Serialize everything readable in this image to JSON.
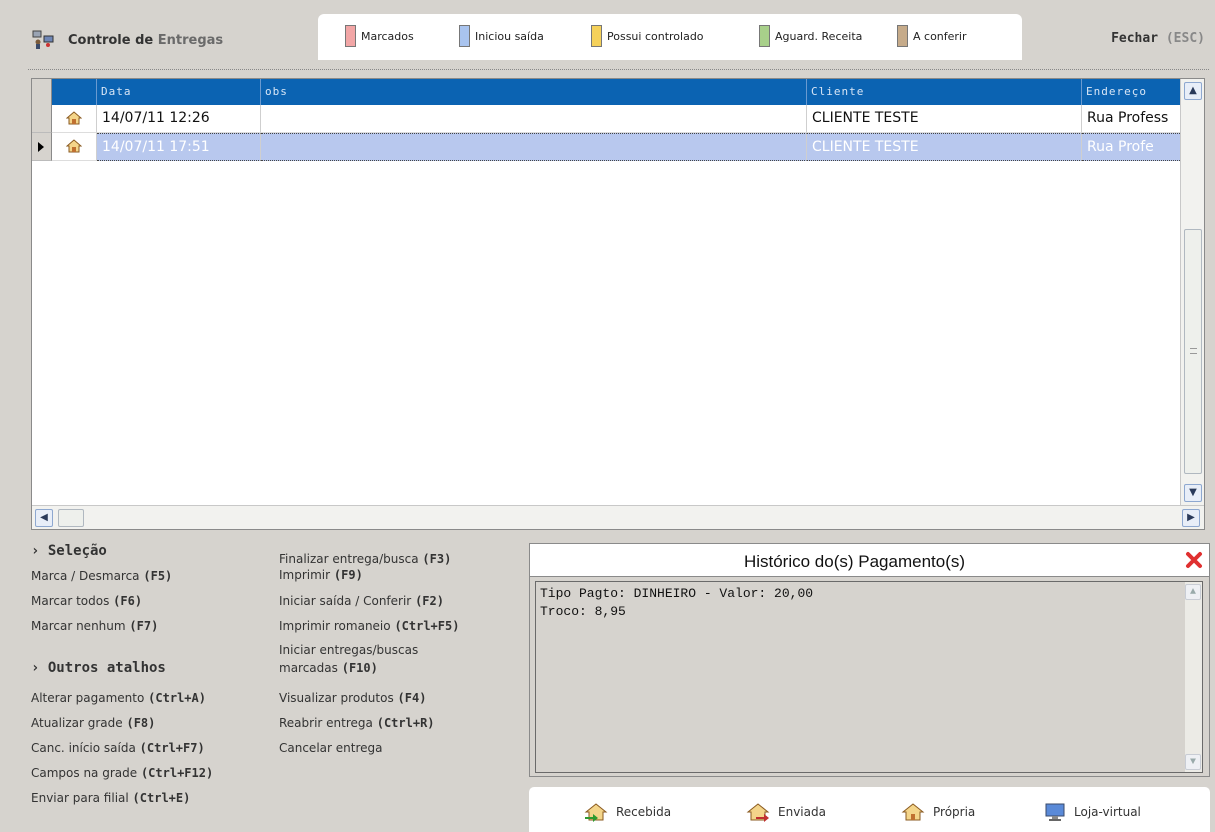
{
  "header": {
    "title_part1": "Controle de",
    "title_part2": "Entregas",
    "close_label": "Fechar",
    "close_key": "(ESC)"
  },
  "legend": [
    {
      "label": "Marcados",
      "color": "#f2a6a6"
    },
    {
      "label": "Iniciou saída",
      "color": "#a9c4ef"
    },
    {
      "label": "Possui controlado",
      "color": "#f5d15a"
    },
    {
      "label": "Aguard. Receita",
      "color": "#a8d08a"
    },
    {
      "label": "A conferir",
      "color": "#c6ab8a"
    }
  ],
  "grid": {
    "columns": [
      "Data",
      "obs",
      "Cliente",
      "Endereço"
    ],
    "rows": [
      {
        "data": "14/07/11 12:26",
        "obs": "",
        "cliente": "CLIENTE TESTE",
        "endereco": "Rua Profess",
        "selected": false
      },
      {
        "data": "14/07/11 17:51",
        "obs": "",
        "cliente": "CLIENTE TESTE",
        "endereco": "Rua Profe",
        "selected": true
      }
    ]
  },
  "shortcuts": {
    "selecao_title": "› Seleção",
    "selecao": [
      {
        "text": "Marca / Desmarca",
        "key": "(F5)"
      },
      {
        "text": "Marcar todos",
        "key": "(F6)"
      },
      {
        "text": "Marcar nenhum",
        "key": "(F7)"
      }
    ],
    "outros_title": "› Outros atalhos",
    "outros": [
      {
        "text": "Alterar pagamento",
        "key": "(Ctrl+A)"
      },
      {
        "text": "Atualizar grade",
        "key": "(F8)"
      },
      {
        "text": "Canc. início saída",
        "key": "(Ctrl+F7)"
      },
      {
        "text": "Campos na grade",
        "key": "(Ctrl+F12)"
      },
      {
        "text": "Enviar para filial",
        "key": "(Ctrl+E)"
      }
    ],
    "acoes": [
      {
        "text": "Finalizar entrega/busca",
        "key": "(F3)"
      },
      {
        "text": "Imprimir",
        "key": "(F9)"
      },
      {
        "text": "Iniciar saída / Conferir",
        "key": "(F2)"
      },
      {
        "text": "Imprimir romaneio",
        "key": "(Ctrl+F5)"
      },
      {
        "text": "Iniciar entregas/buscas",
        "key": ""
      },
      {
        "text": "marcadas",
        "key": "(F10)"
      },
      {
        "text": "Visualizar produtos",
        "key": "(F4)"
      },
      {
        "text": "Reabrir entrega",
        "key": "(Ctrl+R)"
      },
      {
        "text": "Cancelar entrega",
        "key": ""
      }
    ]
  },
  "history": {
    "title": "Histórico do(s) Pagamento(s)",
    "lines": [
      "Tipo Pagto: DINHEIRO - Valor: 20,00",
      "Troco: 8,95"
    ]
  },
  "bottom_legend": [
    {
      "label": "Recebida",
      "icon": "house-received-icon"
    },
    {
      "label": "Enviada",
      "icon": "house-sent-icon"
    },
    {
      "label": "Própria",
      "icon": "house-own-icon"
    },
    {
      "label": "Loja-virtual",
      "icon": "monitor-icon"
    }
  ]
}
